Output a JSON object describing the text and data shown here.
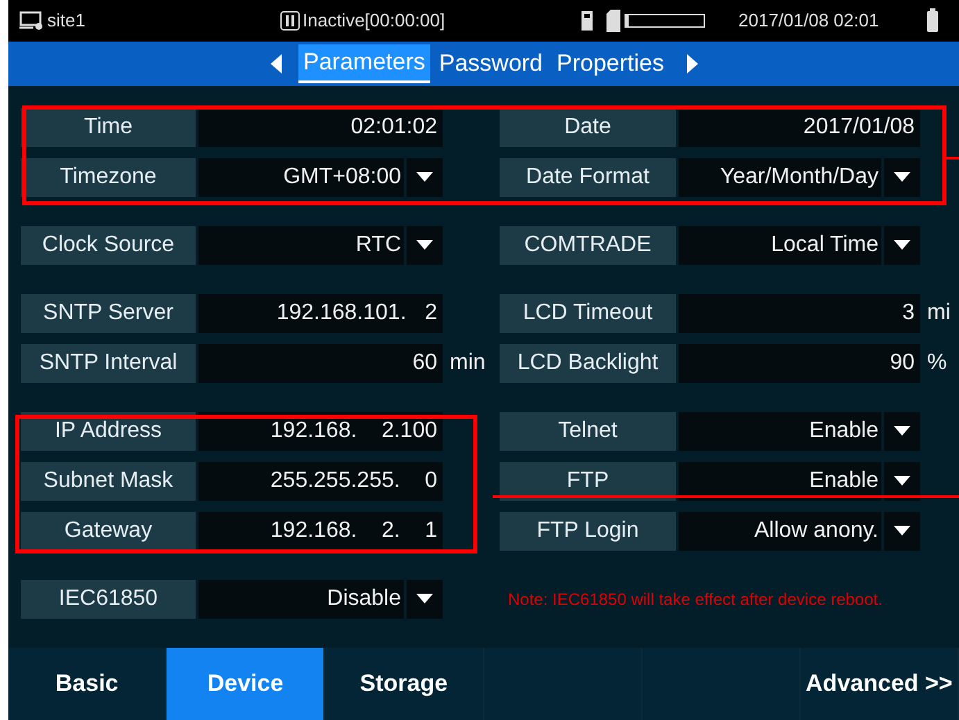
{
  "status_bar": {
    "site": "site1",
    "recording": "Inactive[00:00:00]",
    "datetime": "2017/01/08 02:01"
  },
  "tabs": [
    {
      "label": "Parameters",
      "selected": true
    },
    {
      "label": "Password",
      "selected": false
    },
    {
      "label": "Properties",
      "selected": false
    }
  ],
  "groups": [
    {
      "rows": [
        [
          {
            "label": "Time",
            "value": "02:01:02",
            "kind": "text"
          },
          {
            "label": "Date",
            "value": "2017/01/08",
            "kind": "text"
          }
        ],
        [
          {
            "label": "Timezone",
            "value": "GMT+08:00",
            "kind": "select"
          },
          {
            "label": "Date Format",
            "value": "Year/Month/Day",
            "kind": "select"
          }
        ]
      ]
    },
    {
      "rows": [
        [
          {
            "label": "Clock Source",
            "value": "RTC",
            "kind": "select"
          },
          {
            "label": "COMTRADE",
            "value": "Local Time",
            "kind": "select"
          }
        ]
      ]
    },
    {
      "rows": [
        [
          {
            "label": "SNTP Server",
            "value": "192.168.101.   2",
            "kind": "text"
          },
          {
            "label": "LCD Timeout",
            "value": "3",
            "kind": "text",
            "unit": "mi"
          }
        ],
        [
          {
            "label": "SNTP Interval",
            "value": "60",
            "kind": "text",
            "unit": "min"
          },
          {
            "label": "LCD Backlight",
            "value": "90",
            "kind": "text",
            "unit": "%"
          }
        ]
      ]
    },
    {
      "rows": [
        [
          {
            "label": "IP Address",
            "value": "192.168.    2.100",
            "kind": "text"
          },
          {
            "label": "Telnet",
            "value": "Enable",
            "kind": "select"
          }
        ],
        [
          {
            "label": "Subnet Mask",
            "value": "255.255.255.    0",
            "kind": "text"
          },
          {
            "label": "FTP",
            "value": "Enable",
            "kind": "select"
          }
        ],
        [
          {
            "label": "Gateway",
            "value": "192.168.    2.    1",
            "kind": "text"
          },
          {
            "label": "FTP Login",
            "value": "Allow anony.",
            "kind": "select"
          }
        ]
      ]
    },
    {
      "rows": [
        [
          {
            "label": "IEC61850",
            "value": "Disable",
            "kind": "select"
          },
          {
            "kind": "note",
            "text": "Note: IEC61850 will take effect after device reboot."
          }
        ]
      ]
    }
  ],
  "bottom_tabs": [
    {
      "label": "Basic",
      "selected": false
    },
    {
      "label": "Device",
      "selected": true
    },
    {
      "label": "Storage",
      "selected": false
    },
    {
      "selected": false
    },
    {
      "selected": false
    },
    {
      "label": "Advanced >>",
      "selected": false
    }
  ]
}
